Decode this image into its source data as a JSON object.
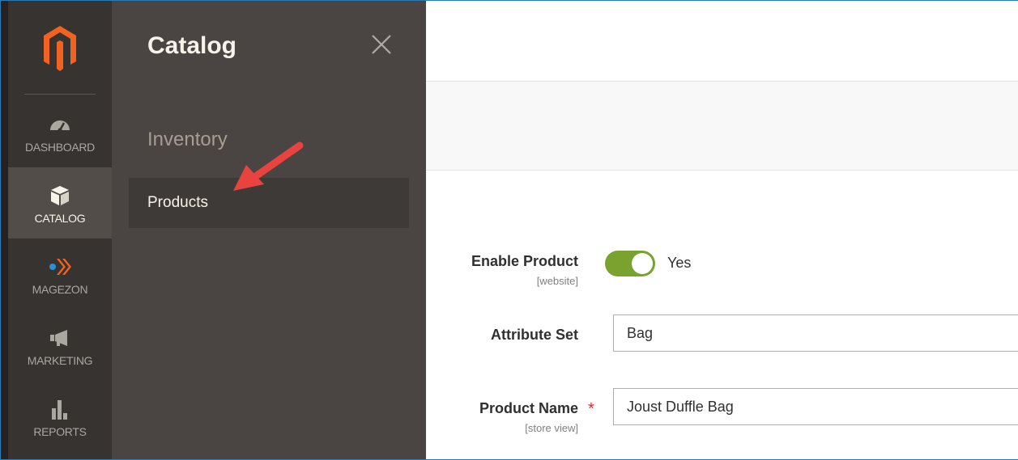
{
  "nav": {
    "logo": "magento-logo",
    "items": [
      {
        "label": "DASHBOARD",
        "icon": "dashboard-icon"
      },
      {
        "label": "CATALOG",
        "icon": "catalog-box-icon",
        "active": true
      },
      {
        "label": "MAGEZON",
        "icon": "magezon-icon"
      },
      {
        "label": "MARKETING",
        "icon": "megaphone-icon"
      },
      {
        "label": "REPORTS",
        "icon": "bar-chart-icon"
      }
    ]
  },
  "flyout": {
    "title": "Catalog",
    "section": "Inventory",
    "items": [
      {
        "label": "Products"
      }
    ]
  },
  "form": {
    "enable_product": {
      "label": "Enable Product",
      "scope": "[website]",
      "value": "Yes"
    },
    "attribute_set": {
      "label": "Attribute Set",
      "value": "Bag"
    },
    "product_name": {
      "label": "Product Name",
      "scope": "[store view]",
      "required_mark": "*",
      "value": "Joust Duffle Bag"
    }
  },
  "colors": {
    "nav_bg": "#373330",
    "flyout_bg": "#4a4542",
    "toggle_on": "#79a22e",
    "logo_orange": "#f26322",
    "required": "#e22626",
    "annotation_arrow": "#e8433f"
  }
}
